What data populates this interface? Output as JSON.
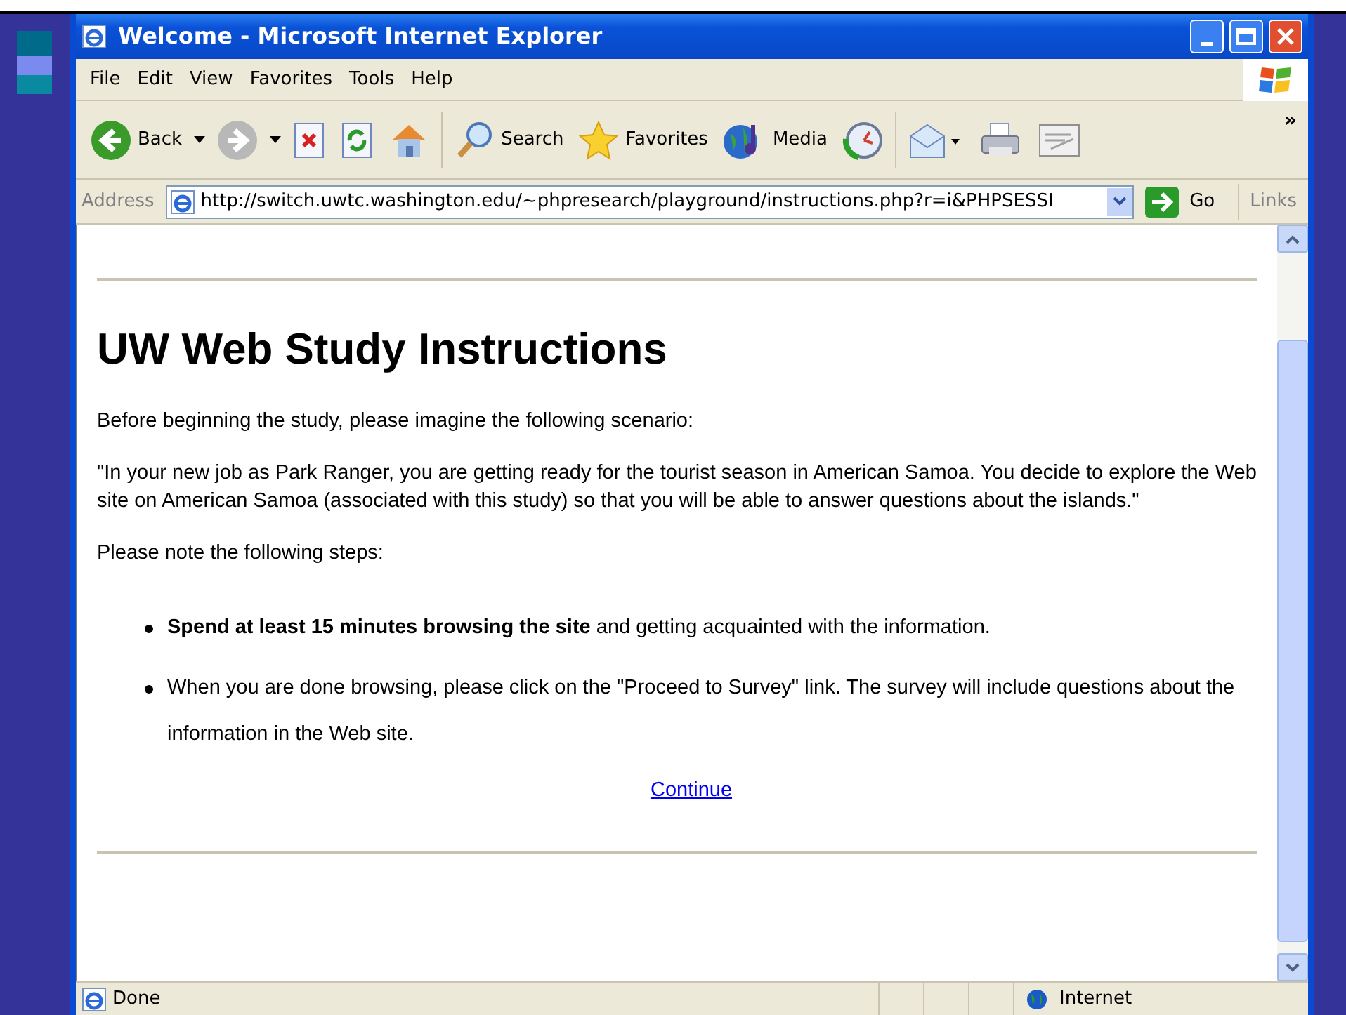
{
  "window": {
    "title": "Welcome - Microsoft Internet Explorer"
  },
  "menu": [
    "File",
    "Edit",
    "View",
    "Favorites",
    "Tools",
    "Help"
  ],
  "toolbar": [
    {
      "kind": "back",
      "label": "Back"
    },
    {
      "kind": "forward"
    },
    {
      "kind": "stop"
    },
    {
      "kind": "refresh"
    },
    {
      "kind": "home"
    },
    {
      "kind": "search",
      "label": "Search"
    },
    {
      "kind": "favorites",
      "label": "Favorites"
    },
    {
      "kind": "media",
      "label": "Media"
    },
    {
      "kind": "history"
    },
    {
      "kind": "mail"
    },
    {
      "kind": "print"
    },
    {
      "kind": "edit"
    }
  ],
  "toolbar_more": "»",
  "address": {
    "label": "Address",
    "url": "http://switch.uwtc.washington.edu/~phpresearch/playground/instructions.php?r=i&PHPSESSI",
    "go": "Go",
    "links": "Links"
  },
  "page": {
    "heading": "UW Web Study Instructions",
    "intro": "Before beginning the study, please imagine the following scenario:",
    "scenario": "\"In your new job as Park Ranger, you are getting ready for the tourist season in American Samoa. You decide to explore the Web site on American Samoa (associated with this study) so that you will be able to answer questions about the islands.\"",
    "note": "Please note the following steps:",
    "steps": [
      "**Spend at least 15 minutes browsing the site** and getting acquainted with the information.",
      "When you are done browsing, please click on the \"Proceed to Survey\" link. The survey will include questions about the information in the Web site."
    ],
    "link": "Continue"
  },
  "status": {
    "text": "Done",
    "zone": "Internet"
  }
}
